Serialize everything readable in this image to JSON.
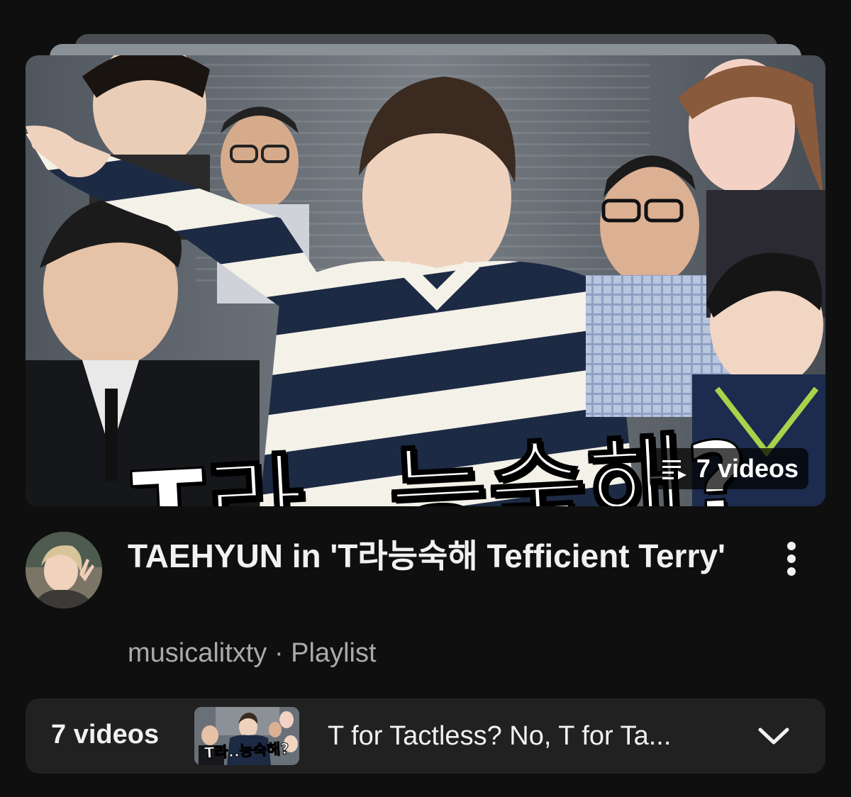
{
  "playlist": {
    "thumbnail_overlay_text": "T라..능숙해?",
    "video_count_badge": "7 videos",
    "title": "TAEHYUN in 'T라능숙해 Tefficient Terry'",
    "channel": "musicalitxty",
    "separator": "·",
    "type": "Playlist"
  },
  "bottom_bar": {
    "count_label": "7 videos",
    "mini_thumbnail_text": "T라..능숙해?",
    "current_video_title": "T for Tactless? No, T for Ta..."
  },
  "icons": {
    "badge_icon": "playlist-play-icon",
    "more_icon": "more-vertical-icon",
    "expand_icon": "chevron-down-icon"
  }
}
